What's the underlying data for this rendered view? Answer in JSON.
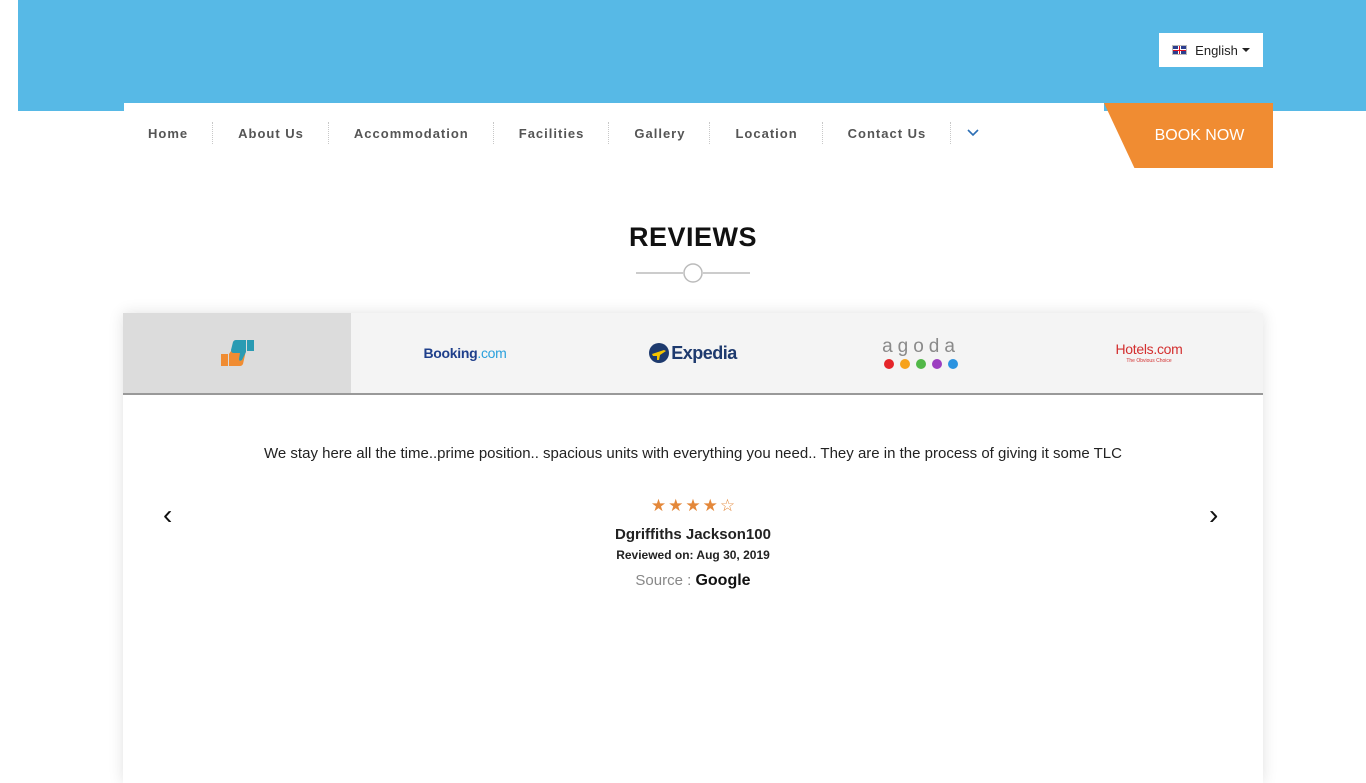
{
  "header": {
    "language": {
      "label": "English",
      "flag_icon": "uk-flag-icon"
    },
    "book_now_label": "BOOK NOW",
    "colors": {
      "band": "#57b9e6",
      "book_now": "#f08c32"
    }
  },
  "nav": {
    "items": [
      {
        "label": "Home"
      },
      {
        "label": "About Us"
      },
      {
        "label": "Accommodation"
      },
      {
        "label": "Facilities"
      },
      {
        "label": "Gallery"
      },
      {
        "label": "Location"
      },
      {
        "label": "Contact Us"
      }
    ],
    "more_icon": "chevron-down-icon"
  },
  "section": {
    "title": "REVIEWS"
  },
  "review_tabs": [
    {
      "name": "thumbs-icon",
      "active": true
    },
    {
      "brand": "Booking",
      "suffix": ".com"
    },
    {
      "brand": "Expedia"
    },
    {
      "brand": "agoda"
    },
    {
      "brand": "Hotels.com",
      "tagline": "The Obvious Choice"
    }
  ],
  "review": {
    "text": "We stay here all the time..prime position.. spacious units with everything you need.. They are in the process of giving it some TLC",
    "rating": 4,
    "max_rating": 5,
    "reviewer": "Dgriffiths Jackson100",
    "date_line": "Reviewed on: Aug 30, 2019",
    "source_label": "Source : ",
    "source": "Google",
    "star_color": "#e4883a"
  },
  "carousel": {
    "prev_icon": "‹",
    "next_icon": "›"
  }
}
